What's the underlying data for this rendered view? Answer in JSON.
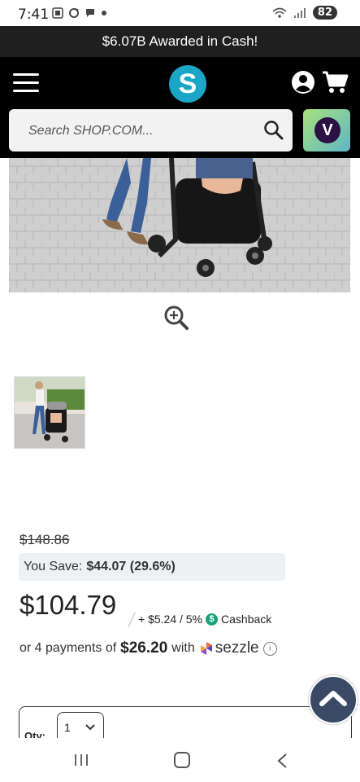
{
  "status_bar": {
    "time": "7:41",
    "battery": "82"
  },
  "promo": {
    "text": "$6.07B Awarded in Cash!"
  },
  "header": {
    "logo_letter": "S",
    "search_placeholder": "Search SHOP.COM...",
    "v_letter": "V"
  },
  "pricing": {
    "old_price": "$148.86",
    "you_save_label": "You Save:",
    "you_save_value": "$44.07 (29.6%)",
    "price": "$104.79",
    "cashback_text": "+ $5.24 / 5%",
    "cashback_icon": "$",
    "cashback_label": "Cashback",
    "payments_prefix": "or 4 payments of",
    "payments_amount": "$26.20",
    "payments_with": "with",
    "sezzle_label": "sezzle",
    "info_icon": "i"
  },
  "quantity": {
    "label": "Qty:",
    "value": "1"
  },
  "colors": {
    "header_bg": "#000000",
    "promo_bg": "#1f1f1f",
    "logo_bg": "#1aa7c7",
    "cashback_green": "#1aa37c",
    "scroll_top_bg": "#3a4a66"
  }
}
